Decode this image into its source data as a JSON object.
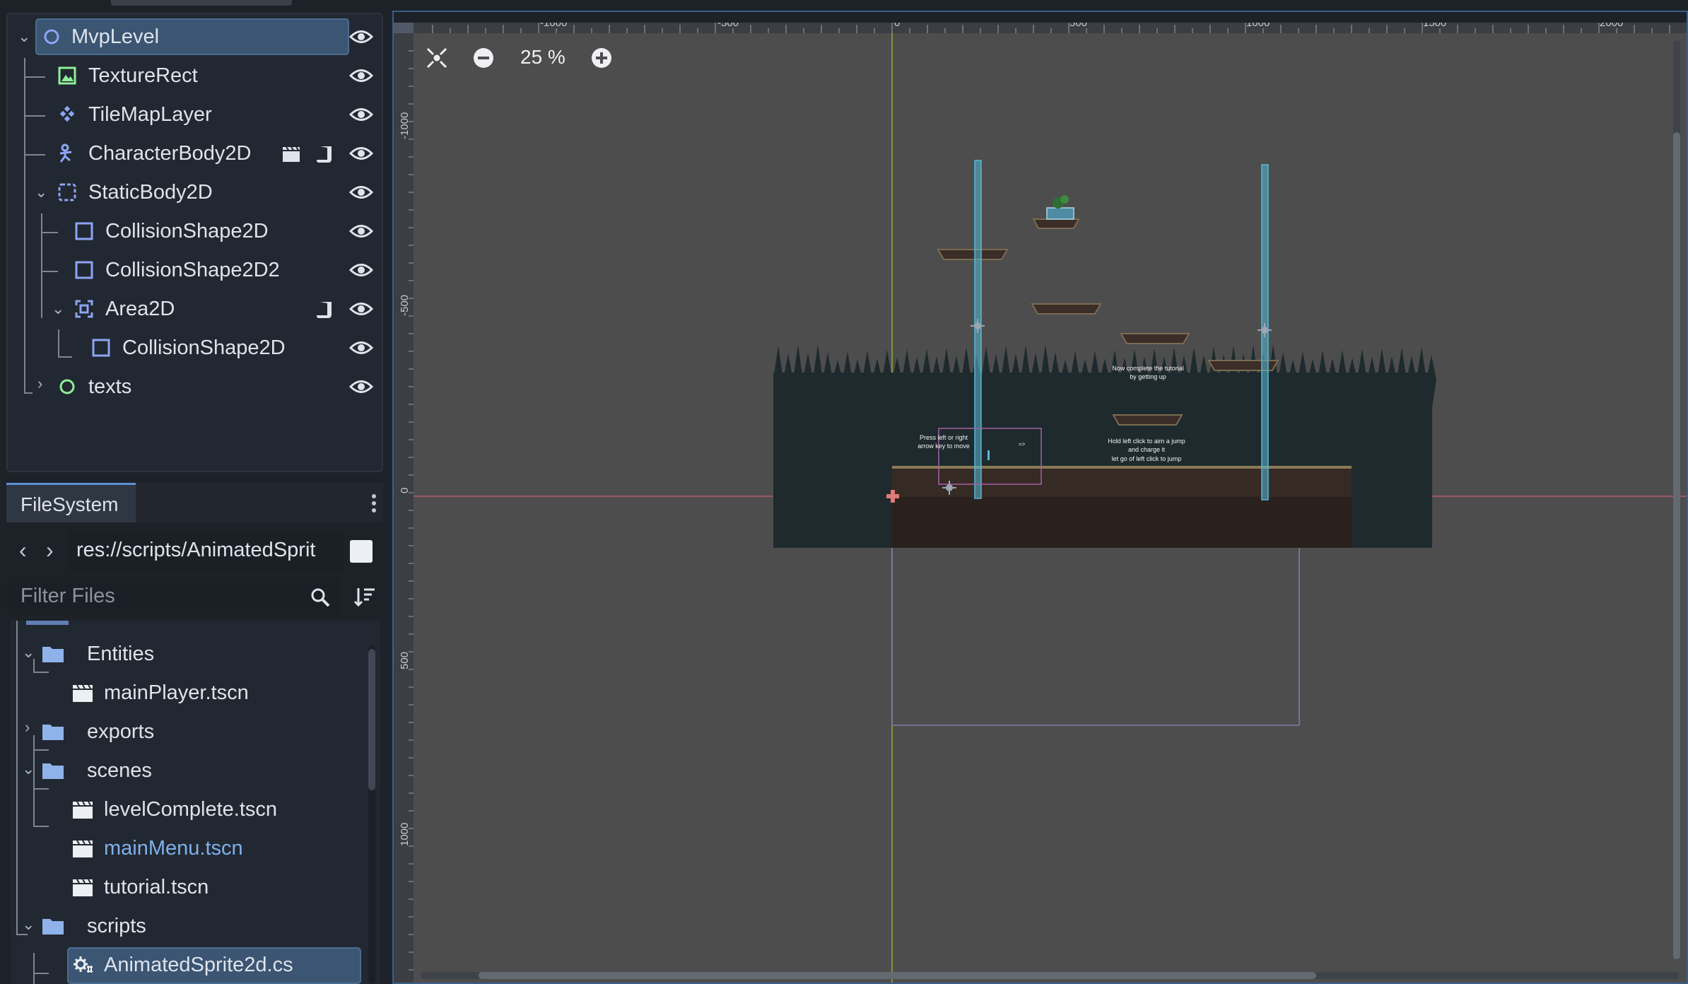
{
  "scene_tree": {
    "nodes": [
      {
        "name": "MvpLevel",
        "icon": "node2d-icon"
      },
      {
        "name": "TextureRect",
        "icon": "texturerect-icon"
      },
      {
        "name": "TileMapLayer",
        "icon": "tilemaplayer-icon"
      },
      {
        "name": "CharacterBody2D",
        "icon": "characterbody2d-icon"
      },
      {
        "name": "StaticBody2D",
        "icon": "staticbody2d-icon"
      },
      {
        "name": "CollisionShape2D",
        "icon": "collisionshape2d-icon"
      },
      {
        "name": "CollisionShape2D2",
        "icon": "collisionshape2d-icon"
      },
      {
        "name": "Area2D",
        "icon": "area2d-icon"
      },
      {
        "name": "CollisionShape2D",
        "icon": "collisionshape2d-icon"
      },
      {
        "name": "texts",
        "icon": "node2d-icon"
      }
    ]
  },
  "filesystem": {
    "tab_label": "FileSystem",
    "path": "res://scripts/AnimatedSprit",
    "filter_placeholder": "Filter Files",
    "items": [
      {
        "name": "Entities",
        "type": "folder"
      },
      {
        "name": "mainPlayer.tscn",
        "type": "scene"
      },
      {
        "name": "exports",
        "type": "folder"
      },
      {
        "name": "scenes",
        "type": "folder"
      },
      {
        "name": "levelComplete.tscn",
        "type": "scene"
      },
      {
        "name": "mainMenu.tscn",
        "type": "scene"
      },
      {
        "name": "tutorial.tscn",
        "type": "scene"
      },
      {
        "name": "scripts",
        "type": "folder"
      },
      {
        "name": "AnimatedSprite2d.cs",
        "type": "script"
      }
    ]
  },
  "viewport": {
    "zoom": "25 %",
    "ruler_x": [
      "-1000",
      "-500",
      "0",
      "500",
      "1000",
      "1500",
      "2000"
    ],
    "ruler_y": [
      "-1000",
      "-500",
      "0",
      "500",
      "1000"
    ],
    "texts": [
      "Press left or right",
      "arrow key to move",
      "Now complete the tutorial",
      "by getting up",
      "Hold left click to aim a jump",
      "and charge it",
      "let go of left click to jump"
    ],
    "colors": {
      "background": "#4d4d4d",
      "ground": "#2a211f",
      "trees": "#1e2a2d",
      "collision": "#57b8d6"
    }
  }
}
